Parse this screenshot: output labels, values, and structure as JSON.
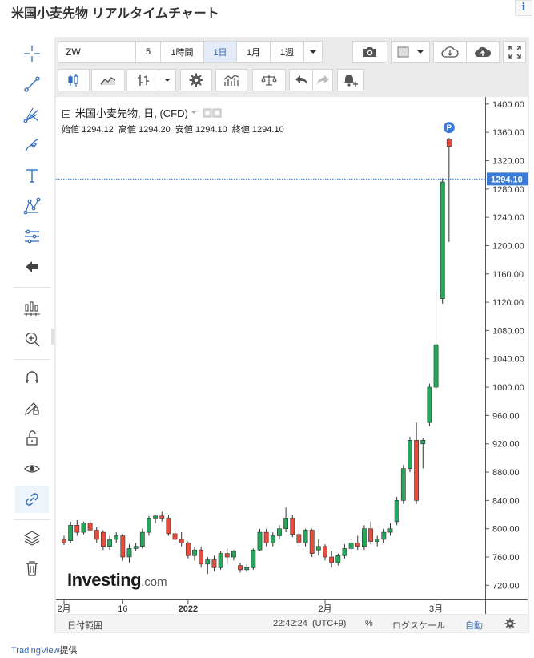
{
  "title": "米国小麦先物 リアルタイムチャート",
  "info_icon": "i",
  "toolbar": {
    "symbol": "ZW",
    "intervals": [
      "5",
      "1時間",
      "1日",
      "1月",
      "1週"
    ],
    "selected_interval": "1日"
  },
  "legend": {
    "name": "米国小麦先物, 日, (CFD)",
    "open_label": "始値",
    "open": "1294.12",
    "high_label": "高値",
    "high": "1294.20",
    "low_label": "安値",
    "low": "1294.10",
    "close_label": "終値",
    "close": "1294.10"
  },
  "logo": {
    "brand": "Investing",
    "suffix": ".com"
  },
  "bottom_bar": {
    "date_range": "日付範囲",
    "time": "22:42:24",
    "timezone": "(UTC+9)",
    "percent": "%",
    "log_scale": "ログスケール",
    "auto": "自動"
  },
  "provider": {
    "name": "TradingView",
    "suffix": "提供"
  },
  "colors": {
    "up": "#26a65b",
    "down": "#e74c3c",
    "accent": "#2f6cbf",
    "price_tag": "#3a7bd5"
  },
  "chart_data": {
    "type": "candlestick",
    "y_axis": {
      "min": 700,
      "max": 1410,
      "ticks": [
        720,
        760,
        800,
        840,
        880,
        920,
        960,
        1000,
        1040,
        1080,
        1120,
        1160,
        1200,
        1240,
        1280,
        1320,
        1360,
        1400
      ]
    },
    "x_tick_labels": [
      {
        "label": "2月",
        "index": 0
      },
      {
        "label": "16",
        "index": 9
      },
      {
        "label": "2022",
        "index": 19
      },
      {
        "label": "2月",
        "index": 40
      },
      {
        "label": "3月",
        "index": 57
      }
    ],
    "last_price": "1294.10",
    "marker": "P",
    "candles": [
      {
        "o": 785,
        "h": 790,
        "l": 777,
        "c": 780
      },
      {
        "o": 783,
        "h": 810,
        "l": 780,
        "c": 805
      },
      {
        "o": 805,
        "h": 812,
        "l": 790,
        "c": 795
      },
      {
        "o": 795,
        "h": 810,
        "l": 792,
        "c": 808
      },
      {
        "o": 808,
        "h": 812,
        "l": 795,
        "c": 798
      },
      {
        "o": 798,
        "h": 802,
        "l": 780,
        "c": 785
      },
      {
        "o": 795,
        "h": 798,
        "l": 770,
        "c": 775
      },
      {
        "o": 775,
        "h": 790,
        "l": 770,
        "c": 785
      },
      {
        "o": 785,
        "h": 795,
        "l": 780,
        "c": 790
      },
      {
        "o": 790,
        "h": 792,
        "l": 755,
        "c": 760
      },
      {
        "o": 760,
        "h": 778,
        "l": 752,
        "c": 772
      },
      {
        "o": 772,
        "h": 780,
        "l": 768,
        "c": 775
      },
      {
        "o": 775,
        "h": 800,
        "l": 772,
        "c": 795
      },
      {
        "o": 795,
        "h": 818,
        "l": 790,
        "c": 815
      },
      {
        "o": 815,
        "h": 820,
        "l": 808,
        "c": 818
      },
      {
        "o": 818,
        "h": 824,
        "l": 810,
        "c": 815
      },
      {
        "o": 815,
        "h": 820,
        "l": 790,
        "c": 793
      },
      {
        "o": 793,
        "h": 800,
        "l": 780,
        "c": 785
      },
      {
        "o": 785,
        "h": 795,
        "l": 775,
        "c": 780
      },
      {
        "o": 780,
        "h": 782,
        "l": 758,
        "c": 762
      },
      {
        "o": 762,
        "h": 775,
        "l": 755,
        "c": 770
      },
      {
        "o": 770,
        "h": 775,
        "l": 745,
        "c": 750
      },
      {
        "o": 750,
        "h": 760,
        "l": 736,
        "c": 756
      },
      {
        "o": 756,
        "h": 762,
        "l": 740,
        "c": 745
      },
      {
        "o": 745,
        "h": 768,
        "l": 742,
        "c": 765
      },
      {
        "o": 765,
        "h": 772,
        "l": 750,
        "c": 760
      },
      {
        "o": 760,
        "h": 770,
        "l": 755,
        "c": 768
      },
      {
        "o": 748,
        "h": 752,
        "l": 738,
        "c": 742
      },
      {
        "o": 742,
        "h": 750,
        "l": 738,
        "c": 745
      },
      {
        "o": 745,
        "h": 772,
        "l": 742,
        "c": 770
      },
      {
        "o": 770,
        "h": 800,
        "l": 768,
        "c": 795
      },
      {
        "o": 795,
        "h": 800,
        "l": 775,
        "c": 780
      },
      {
        "o": 780,
        "h": 795,
        "l": 775,
        "c": 790
      },
      {
        "o": 790,
        "h": 805,
        "l": 785,
        "c": 800
      },
      {
        "o": 800,
        "h": 830,
        "l": 795,
        "c": 815
      },
      {
        "o": 815,
        "h": 820,
        "l": 788,
        "c": 792
      },
      {
        "o": 792,
        "h": 798,
        "l": 775,
        "c": 780
      },
      {
        "o": 780,
        "h": 800,
        "l": 775,
        "c": 798
      },
      {
        "o": 798,
        "h": 800,
        "l": 760,
        "c": 765
      },
      {
        "o": 770,
        "h": 785,
        "l": 762,
        "c": 775
      },
      {
        "o": 775,
        "h": 778,
        "l": 755,
        "c": 760
      },
      {
        "o": 760,
        "h": 768,
        "l": 745,
        "c": 752
      },
      {
        "o": 752,
        "h": 765,
        "l": 748,
        "c": 762
      },
      {
        "o": 762,
        "h": 778,
        "l": 758,
        "c": 772
      },
      {
        "o": 772,
        "h": 785,
        "l": 765,
        "c": 780
      },
      {
        "o": 780,
        "h": 790,
        "l": 770,
        "c": 775
      },
      {
        "o": 775,
        "h": 805,
        "l": 770,
        "c": 800
      },
      {
        "o": 800,
        "h": 810,
        "l": 778,
        "c": 782
      },
      {
        "o": 782,
        "h": 790,
        "l": 775,
        "c": 785
      },
      {
        "o": 785,
        "h": 800,
        "l": 780,
        "c": 795
      },
      {
        "o": 795,
        "h": 808,
        "l": 790,
        "c": 800
      },
      {
        "o": 810,
        "h": 845,
        "l": 805,
        "c": 840
      },
      {
        "o": 840,
        "h": 890,
        "l": 835,
        "c": 885
      },
      {
        "o": 885,
        "h": 930,
        "l": 880,
        "c": 925
      },
      {
        "o": 925,
        "h": 950,
        "l": 835,
        "c": 840
      },
      {
        "o": 920,
        "h": 928,
        "l": 885,
        "c": 925
      },
      {
        "o": 950,
        "h": 1005,
        "l": 945,
        "c": 1000
      },
      {
        "o": 1000,
        "h": 1135,
        "l": 995,
        "c": 1060
      },
      {
        "o": 1125,
        "h": 1295,
        "l": 1118,
        "c": 1290
      },
      {
        "o": 1350,
        "h": 1352,
        "l": 1205,
        "c": 1340
      }
    ]
  }
}
